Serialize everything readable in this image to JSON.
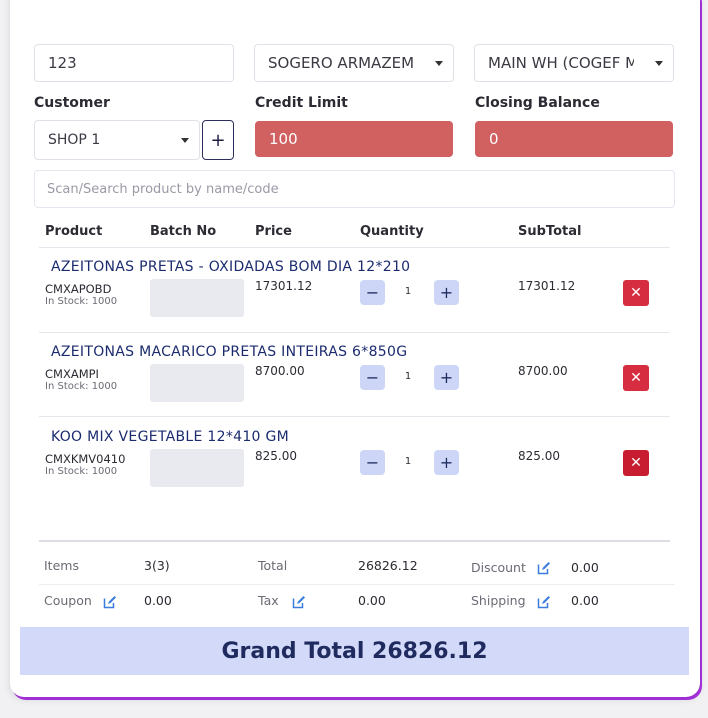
{
  "top": {
    "ref_value": "123",
    "supplier_select": "SOGERO ARMAZEM",
    "warehouse_select": "MAIN WH (COGEF MAIN"
  },
  "customer": {
    "label": "Customer",
    "value": "SHOP 1",
    "add_label": "+"
  },
  "credit_limit": {
    "label": "Credit Limit",
    "value": "100"
  },
  "closing_balance": {
    "label": "Closing Balance",
    "value": "0"
  },
  "search": {
    "placeholder": "Scan/Search product by name/code"
  },
  "table": {
    "headers": [
      "Product",
      "Batch No",
      "Price",
      "Quantity",
      "SubTotal"
    ],
    "rows": [
      {
        "name": "AZEITONAS PRETAS - OXIDADAS BOM DIA 12*210",
        "code": "CMXAPOBD",
        "stock": "In Stock: 1000",
        "price": "17301.12",
        "qty": "1",
        "subtotal": "17301.12"
      },
      {
        "name": "AZEITONAS MACARICO PRETAS INTEIRAS 6*850G",
        "code": "CMXAMPI",
        "stock": "In Stock: 1000",
        "price": "8700.00",
        "qty": "1",
        "subtotal": "8700.00"
      },
      {
        "name": "KOO MIX VEGETABLE 12*410 GM",
        "code": "CMXKMV0410",
        "stock": "In Stock: 1000",
        "price": "825.00",
        "qty": "1",
        "subtotal": "825.00"
      }
    ],
    "minus": "−",
    "plus": "+",
    "delete": "✕"
  },
  "summary": {
    "items_label": "Items",
    "items_value": "3(3)",
    "total_label": "Total",
    "total_value": "26826.12",
    "discount_label": "Discount",
    "discount_value": "0.00",
    "coupon_label": "Coupon",
    "coupon_value": "0.00",
    "tax_label": "Tax",
    "tax_value": "0.00",
    "shipping_label": "Shipping",
    "shipping_value": "0.00"
  },
  "grand_total": "Grand Total 26826.12",
  "colors": {
    "accent_border": "#a12fd6",
    "danger": "#d62e40",
    "credit_fill": "#d16161",
    "grand_bg": "#d3daf9",
    "navy": "#1b2b6e"
  }
}
